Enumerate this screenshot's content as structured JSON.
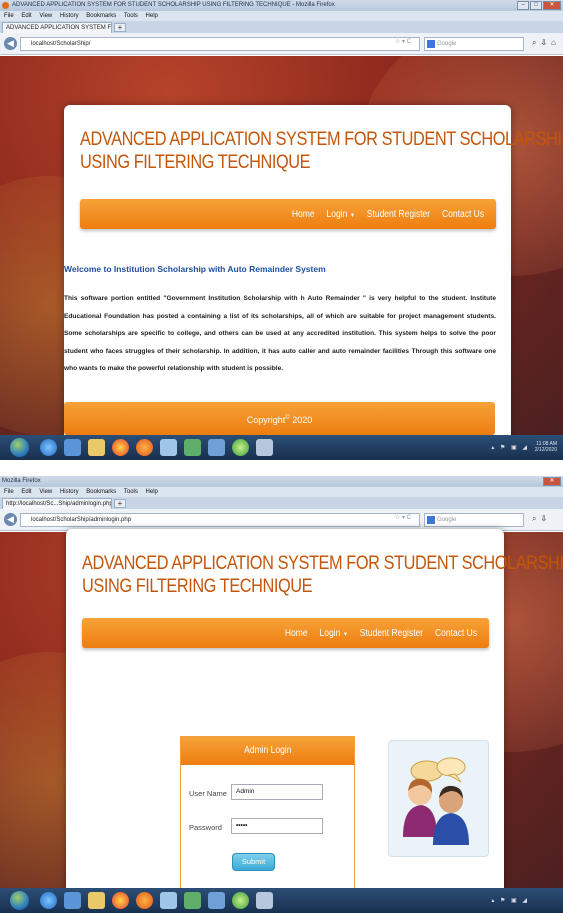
{
  "screen1": {
    "window_title": "ADVANCED APPLICATION SYSTEM FOR STUDENT SCHOLARSHIP USING FILTERING TECHNIQUE - Mozilla Firefox",
    "menu": [
      "File",
      "Edit",
      "View",
      "History",
      "Bookmarks",
      "Tools",
      "Help"
    ],
    "tab_title": "ADVANCED APPLICATION SYSTEM FOR ...",
    "url": "localhost/ScholarShip/",
    "search_placeholder": "Google",
    "site_title_line1": "ADVANCED APPLICATION SYSTEM FOR STUDENT SCHOLARSHIP",
    "site_title_line2": "USING FILTERING TECHNIQUE",
    "nav": {
      "home": "Home",
      "login": "Login",
      "register": "Student Register",
      "contact": "Contact Us"
    },
    "welcome_heading": "Welcome to Institution Scholarship with Auto Remainder System",
    "body_text": "This software portion entitled \"Government Institution Scholarship with h Auto Remainder \" is very helpful to the student. Institute Educational Foundation has posted a containing a list of its scholarships, all of which are suitable for project management students. Some scholarships are specific to college, and others can be used at any accredited institution. This system helps to solve the poor student who faces struggles of their scholarship. In addition, it has auto caller and auto remainder facilities Through this software one who wants to make the powerful relationship with student is possible.",
    "footer_text": "Copyright",
    "footer_symbol": "©",
    "footer_year": "2020",
    "clock_time": "11:08 AM",
    "clock_date": "2/12/2020"
  },
  "screen2": {
    "window_title": "Mozilla Firefox",
    "menu": [
      "File",
      "Edit",
      "View",
      "History",
      "Bookmarks",
      "Tools",
      "Help"
    ],
    "tab_title": "http://localhost/Sc...Ship/adminlogin.php",
    "url": "localhost/ScholarShip/adminlogin.php",
    "search_placeholder": "Google",
    "site_title_line1": "ADVANCED APPLICATION SYSTEM FOR STUDENT SCHOLARSHIP",
    "site_title_line2": "USING FILTERING TECHNIQUE",
    "nav": {
      "home": "Home",
      "login": "Login",
      "register": "Student Register",
      "contact": "Contact Us"
    },
    "login_title": "Admin Login",
    "username_label": "User Name",
    "username_value": "Admin",
    "password_label": "Password",
    "password_value": "•••••",
    "submit_label": "Submit"
  },
  "colors": {
    "accent_orange": "#ee7d10",
    "title_orange": "#c4560c",
    "welcome_blue": "#1e4f9c",
    "submit_blue": "#3aa9d6"
  }
}
